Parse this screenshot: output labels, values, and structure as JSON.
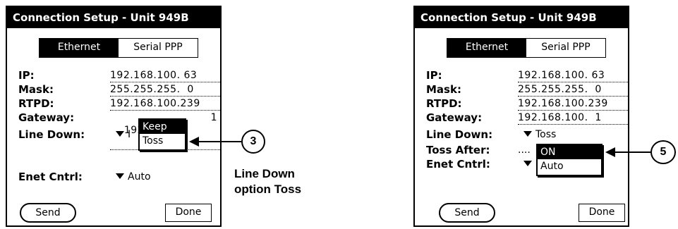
{
  "screens": [
    {
      "title": "Connection Setup - Unit 949B",
      "tabs": [
        {
          "label": "Ethernet",
          "active": true
        },
        {
          "label": "Serial PPP",
          "active": false
        }
      ],
      "fields": {
        "ip_label": "IP:",
        "ip_value": "192.168.100. 63",
        "mask_label": "Mask:",
        "mask_value": "255.255.255.  0",
        "rtpd_label": "RTPD:",
        "rtpd_value": "192.168.100.239",
        "gateway_label": "Gateway:",
        "gateway_value_left": "192.1",
        "gateway_value_right": "1",
        "line_down_label": "Line Down:",
        "line_down_value": "I",
        "enet_label": "Enet Cntrl:",
        "enet_value": "Auto"
      },
      "popup": {
        "items": [
          "Keep",
          "Toss"
        ],
        "selected": "Keep"
      },
      "buttons": {
        "send": "Send",
        "done": "Done"
      },
      "callout": {
        "number": "3",
        "caption_line1": "Line Down",
        "caption_line2": "option Toss"
      }
    },
    {
      "title": "Connection Setup - Unit 949B",
      "tabs": [
        {
          "label": "Ethernet",
          "active": true
        },
        {
          "label": "Serial PPP",
          "active": false
        }
      ],
      "fields": {
        "ip_label": "IP:",
        "ip_value": "192.168.100. 63",
        "mask_label": "Mask:",
        "mask_value": "255.255.255.  0",
        "rtpd_label": "RTPD:",
        "rtpd_value": "192.168.100.239",
        "gateway_label": "Gateway:",
        "gateway_value": "192.168.100.  1",
        "line_down_label": "Line Down:",
        "line_down_value": "Toss",
        "toss_after_label": "Toss After:",
        "toss_after_value": "....",
        "enet_label": "Enet Cntrl:"
      },
      "popup": {
        "items": [
          "ON",
          "Auto"
        ],
        "selected": "ON"
      },
      "buttons": {
        "send": "Send",
        "done": "Done"
      },
      "callout": {
        "number": "5"
      }
    }
  ],
  "colors": {
    "ink": "#000000",
    "paper": "#ffffff"
  }
}
